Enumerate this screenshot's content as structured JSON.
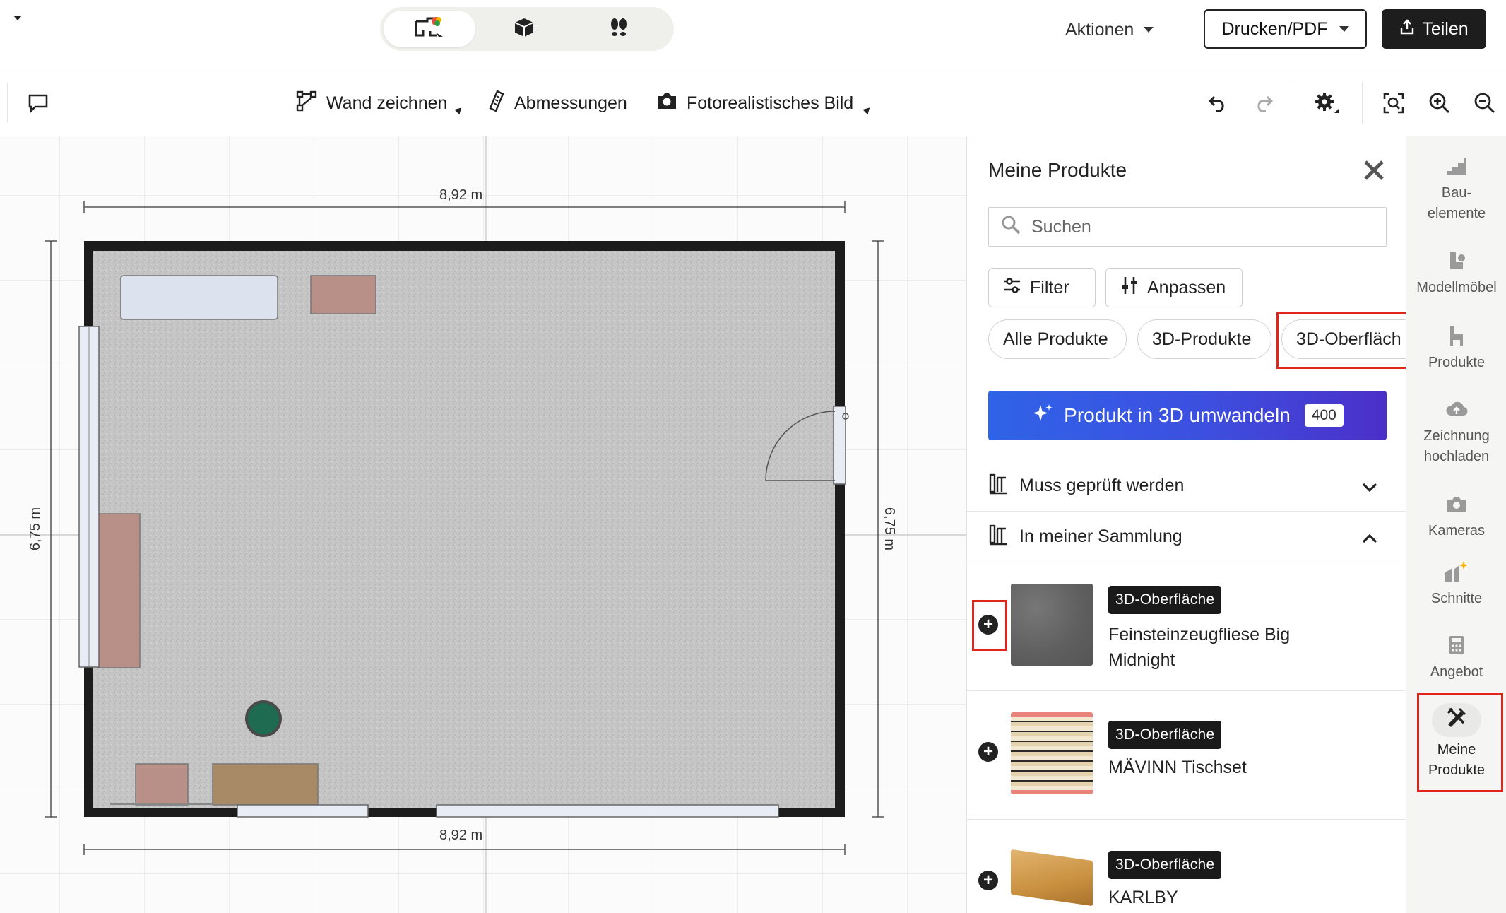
{
  "topbar": {
    "actions_label": "Aktionen",
    "print_label": "Drucken/PDF",
    "share_label": "Teilen",
    "view_modes": [
      "2d-plan-icon",
      "3d-box-icon",
      "walk-footprints-icon"
    ]
  },
  "toolbar": {
    "draw_wall": "Wand zeichnen",
    "dimensions": "Abmessungen",
    "photo_image": "Fotorealistisches Bild"
  },
  "canvas": {
    "dim_top": "8,92 m",
    "dim_bottom": "8,92 m",
    "dim_left": "6,75 m",
    "dim_right": "6,75 m"
  },
  "panel": {
    "title": "Meine Produkte",
    "search_placeholder": "Suchen",
    "filter_label": "Filter",
    "customize_label": "Anpassen",
    "chips": [
      "Alle Produkte",
      "3D-Produkte",
      "3D-Oberfläch"
    ],
    "convert_label": "Produkt in 3D umwandeln",
    "convert_badge": "400",
    "section_review": "Muss geprüft werden",
    "section_collection": "In meiner Sammlung",
    "products": [
      {
        "tag": "3D-Oberfläche",
        "name": "Feinsteinzeugfliese Big Midnight"
      },
      {
        "tag": "3D-Oberfläche",
        "name": "MÄVINN Tischset"
      },
      {
        "tag": "3D-Oberfläche",
        "name": "KARLBY"
      }
    ]
  },
  "rail": {
    "items": [
      {
        "label": "Bau-\nelemente"
      },
      {
        "label": "Modellmöbel"
      },
      {
        "label": "Produkte"
      },
      {
        "label": "Zeichnung\nhochladen"
      },
      {
        "label": "Kameras"
      },
      {
        "label": "Schnitte"
      },
      {
        "label": "Angebot"
      },
      {
        "label": "Meine\nProdukte"
      }
    ]
  },
  "colors": {
    "accent_red": "#e0261b",
    "gradient_start": "#2f63e8",
    "gradient_end": "#4b2fc8",
    "dark": "#1d1d1d"
  }
}
